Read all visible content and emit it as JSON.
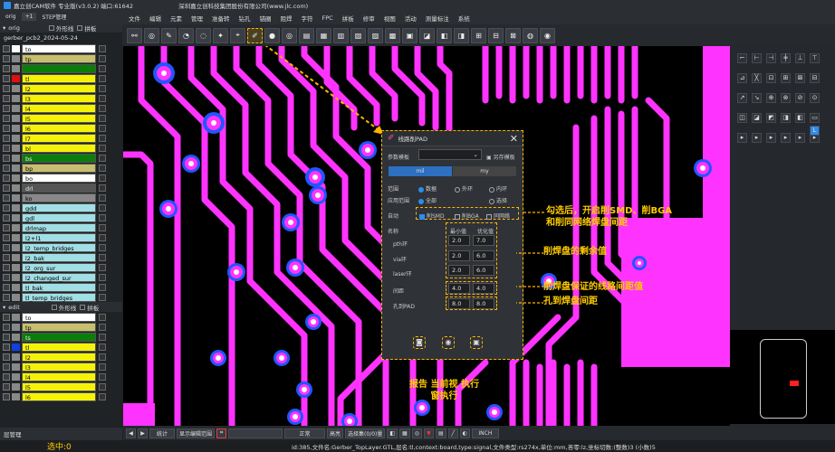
{
  "app": {
    "title": "嘉立创CAM软件 专业版(v3.0.2) 端口:61642",
    "company": "深圳嘉立创科技集团股份有限公司(www.jlc.com)"
  },
  "left_tabs": [
    "orig",
    "+1",
    "STEP管理"
  ],
  "menu": [
    "文件",
    "编辑",
    "元素",
    "管理",
    "准备转",
    "钻孔",
    "锚圈",
    "阻焊",
    "字符",
    "FPC",
    "拼板",
    "修审",
    "视图",
    "活动",
    "测量标注",
    "系统"
  ],
  "orig_group": {
    "title": "orig",
    "opt1": "外形线",
    "opt2": "拼板",
    "file": "gerber_pcb2_2024-05-24"
  },
  "orig_layers": [
    {
      "name": "to",
      "color": "#ffffff",
      "sw": "#ffffff"
    },
    {
      "name": "tp",
      "color": "#c8bf6e",
      "sw": "#888"
    },
    {
      "name": "",
      "color": "#0a7d0a",
      "sw": "#888"
    },
    {
      "name": "tl",
      "color": "#f5f20a",
      "sw": "#e01010"
    },
    {
      "name": "l2",
      "color": "#f5f20a",
      "sw": "#888"
    },
    {
      "name": "l3",
      "color": "#f5f20a",
      "sw": "#888"
    },
    {
      "name": "l4",
      "color": "#f5f20a",
      "sw": "#888"
    },
    {
      "name": "l5",
      "color": "#f5f20a",
      "sw": "#888"
    },
    {
      "name": "l6",
      "color": "#f5f20a",
      "sw": "#888"
    },
    {
      "name": "l7",
      "color": "#f5f20a",
      "sw": "#888"
    },
    {
      "name": "bl",
      "color": "#f5f20a",
      "sw": "#888"
    },
    {
      "name": "bs",
      "color": "#0a7d0a",
      "sw": "#888"
    },
    {
      "name": "bp",
      "color": "#c8bf6e",
      "sw": "#888"
    },
    {
      "name": "bo",
      "color": "#ffffff",
      "sw": "#888"
    },
    {
      "name": "drl",
      "color": "#555555",
      "sw": "#888"
    },
    {
      "name": "ko",
      "color": "#888888",
      "sw": "#888"
    },
    {
      "name": "gdd",
      "color": "#a0dfe6",
      "sw": "#888"
    },
    {
      "name": "gdl",
      "color": "#a0dfe6",
      "sw": "#888"
    },
    {
      "name": "drlmap",
      "color": "#a0dfe6",
      "sw": "#888"
    },
    {
      "name": "l2+l1",
      "color": "#a0dfe6",
      "sw": "#888"
    },
    {
      "name": "l2_temp_bridges",
      "color": "#a0dfe6",
      "sw": "#888"
    },
    {
      "name": "l2_bak",
      "color": "#a0dfe6",
      "sw": "#888"
    },
    {
      "name": "l2_org_sur",
      "color": "#a0dfe6",
      "sw": "#888"
    },
    {
      "name": "l2_changed_sur",
      "color": "#a0dfe6",
      "sw": "#888"
    },
    {
      "name": "tl_bak",
      "color": "#a0dfe6",
      "sw": "#888"
    },
    {
      "name": "tl_temp_bridges",
      "color": "#a0dfe6",
      "sw": "#888"
    }
  ],
  "edit_group": {
    "title": "edit",
    "opt1": "外形线",
    "opt2": "拼板"
  },
  "edit_layers": [
    {
      "name": "to",
      "color": "#ffffff",
      "sw": "#888"
    },
    {
      "name": "tp",
      "color": "#c8bf6e",
      "sw": "#888"
    },
    {
      "name": "ts",
      "color": "#0a7d0a",
      "sw": "#888"
    },
    {
      "name": "tl",
      "color": "#f5f20a",
      "sw": "#1040e0"
    },
    {
      "name": "l2",
      "color": "#f5f20a",
      "sw": "#888"
    },
    {
      "name": "l3",
      "color": "#f5f20a",
      "sw": "#888"
    },
    {
      "name": "l4",
      "color": "#f5f20a",
      "sw": "#888"
    },
    {
      "name": "l5",
      "color": "#f5f20a",
      "sw": "#888"
    },
    {
      "name": "l6",
      "color": "#f5f20a",
      "sw": "#888"
    }
  ],
  "left_bottom": "层管理",
  "dialog": {
    "title": "线路削PAD",
    "param_label": "参数模板",
    "save_btn": "另存模板",
    "mil": "mil",
    "mm": "my",
    "shape_label": "范围",
    "opt_all": "数据",
    "opt_outer": "外环",
    "opt_inner": "内环",
    "pos_label": "应用范围",
    "opt_full": "全部",
    "opt_select": "选择",
    "function_label": "自动",
    "chk1": "削SMD",
    "chk2": "削BGA",
    "chk3": "同网络",
    "col_name": "名称",
    "col_min": "最小值",
    "col_opt": "优化值",
    "rows": [
      {
        "name": "pth环",
        "min": "2.0",
        "opt": "7.0"
      },
      {
        "name": "via环",
        "min": "2.0",
        "opt": "6.0"
      },
      {
        "name": "laser环",
        "min": "2.0",
        "opt": "6.0"
      }
    ],
    "spacing_label": "间距",
    "spacing_min": "4.0",
    "spacing_opt": "4.0",
    "hole_label": "孔到PAD",
    "hole_min": "8.0",
    "hole_opt": "8.0"
  },
  "annotations": {
    "a1_line1": "勾选后，开启削SMD、削BGA",
    "a1_line2": "和削同网络焊盘间距",
    "a2": "削焊盘的剩余值",
    "a3": "削焊盘保证的线路间距值",
    "a4": "孔到焊盘间距",
    "a5_line1": "报告 当前视 执行",
    "a5_line2": "窗执行"
  },
  "bottom": {
    "mode": "统计",
    "btn1": "显示编辑范围",
    "zoom": "正常",
    "check": "高亮",
    "btn2": "选择集(0/0)量",
    "unit": "INCH"
  },
  "status": {
    "selected": "选中:0",
    "info": "id:385,文件名:Gerber_TopLayer.GTL,层名:tl,context:board,type:signal,文件类型:rs274x,单位:mm,吝零:lz,坐标切数:(整数)3 (小数)5"
  },
  "colors": {
    "trace": "#ff33ff",
    "pad_ring": "#2255ff",
    "accent": "#ffb400",
    "annotation": "#ffcc00"
  }
}
